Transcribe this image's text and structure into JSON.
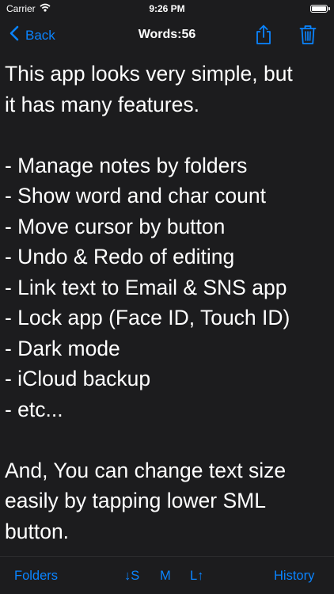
{
  "status": {
    "carrier": "Carrier",
    "time": "9:26 PM"
  },
  "nav": {
    "back_label": "Back",
    "title": "Words:56",
    "icons": [
      "share-icon",
      "trash-icon"
    ]
  },
  "note": {
    "lines": [
      "This app looks very simple, but",
      "it has many features.",
      "",
      "- Manage notes by folders",
      "- Show word and char count",
      "- Move cursor by button",
      "- Undo & Redo of editing",
      "- Link text to Email & SNS app",
      "- Lock app (Face ID, Touch ID)",
      "- Dark mode",
      "- iCloud backup",
      "- etc...",
      "",
      "And, You can change text size",
      "easily by tapping lower SML",
      "button."
    ]
  },
  "toolbar": {
    "folders_label": "Folders",
    "size_small_label": "↓S",
    "size_medium_label": "M",
    "size_large_label": "L↑",
    "history_label": "History"
  },
  "colors": {
    "accent": "#0a84ff",
    "background": "#1c1c1e",
    "text": "#ffffff"
  }
}
